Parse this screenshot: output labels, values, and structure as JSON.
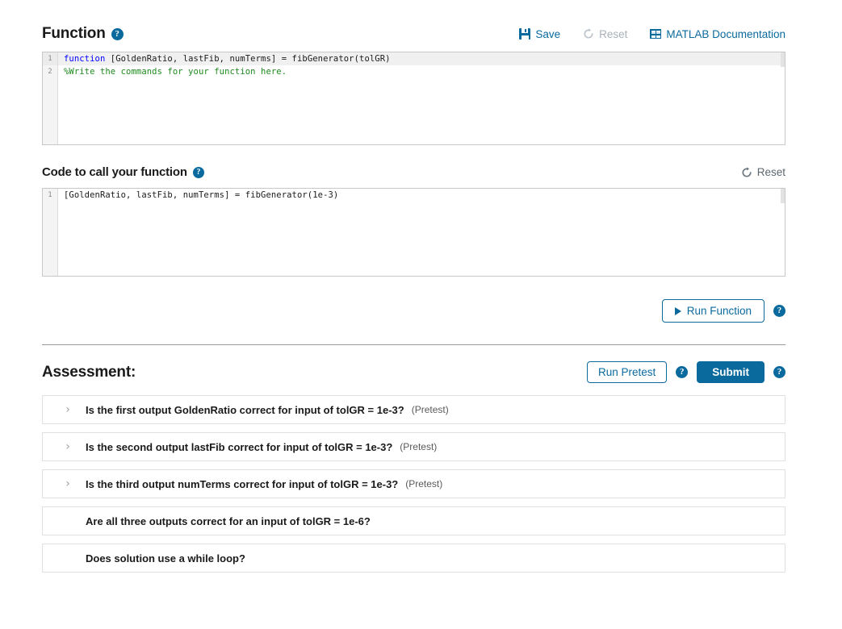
{
  "function_section": {
    "title": "Function",
    "help_icon": "help-icon",
    "toolbar": {
      "save_label": "Save",
      "save_icon": "save-floppy-icon",
      "reset_label": "Reset",
      "reset_icon": "reset-circular-arrow-icon",
      "reset_disabled": true,
      "docs_label": "MATLAB Documentation",
      "docs_icon": "documentation-grid-icon"
    },
    "editor": {
      "lines": [
        {
          "number": "1",
          "highlighted": true,
          "tokens": [
            {
              "text": "function ",
              "style": "keyword"
            },
            {
              "text": "[GoldenRatio, lastFib, numTerms] = fibGenerator(tolGR)",
              "style": "plain"
            }
          ]
        },
        {
          "number": "2",
          "highlighted": false,
          "tokens": [
            {
              "text": "%Write the commands for your function here.",
              "style": "comment"
            }
          ]
        }
      ]
    }
  },
  "call_section": {
    "title": "Code to call your function",
    "help_icon": "help-icon",
    "reset_label": "Reset",
    "reset_icon": "reset-circular-arrow-icon",
    "editor": {
      "lines": [
        {
          "number": "1",
          "highlighted": false,
          "tokens": [
            {
              "text": "[GoldenRatio, lastFib, numTerms] = fibGenerator(1e-3)",
              "style": "plain"
            }
          ]
        }
      ]
    }
  },
  "run": {
    "button_label": "Run Function",
    "play_icon": "play-triangle-icon",
    "help_icon": "help-icon"
  },
  "assessment": {
    "title": "Assessment:",
    "run_pretest_label": "Run Pretest",
    "run_pretest_help_icon": "help-icon",
    "submit_label": "Submit",
    "submit_help_icon": "help-icon",
    "rows": [
      {
        "expandable": true,
        "chevron_icon": "chevron-right-icon",
        "text": "Is the first output GoldenRatio correct for input of tolGR = 1e-3?",
        "tag": "(Pretest)"
      },
      {
        "expandable": true,
        "chevron_icon": "chevron-right-icon",
        "text": "Is the second output lastFib correct for input of tolGR = 1e-3?",
        "tag": "(Pretest)"
      },
      {
        "expandable": true,
        "chevron_icon": "chevron-right-icon",
        "text": "Is the third output numTerms correct for input of tolGR = 1e-3?",
        "tag": "(Pretest)"
      },
      {
        "expandable": false,
        "chevron_icon": "",
        "text": "Are all three outputs correct for an input of tolGR = 1e-6?",
        "tag": ""
      },
      {
        "expandable": false,
        "chevron_icon": "",
        "text": "Does solution use a while loop?",
        "tag": ""
      }
    ]
  },
  "colors": {
    "accent_blue": "#0a6a9e",
    "disabled_gray": "#a8b0b8",
    "reset_gray": "#5b6770",
    "keyword_blue": "#0000ff",
    "comment_green": "#1d8a1d",
    "row_border": "#e0e0e0",
    "editor_border": "#c6c9cc",
    "gutter_bg": "#f4f4f4"
  }
}
